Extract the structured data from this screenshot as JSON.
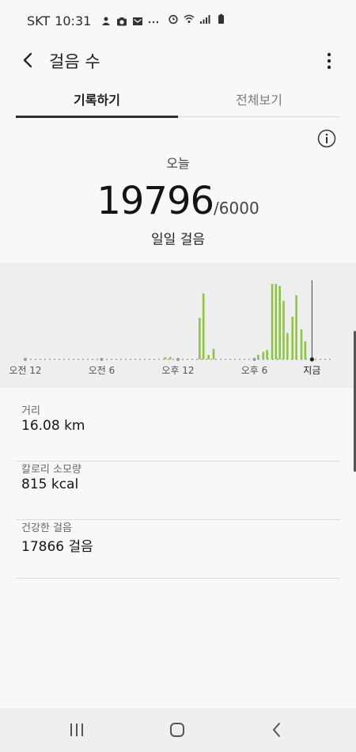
{
  "status": {
    "carrier": "SKT",
    "time": "10:31",
    "left_icons": [
      "notification-icon",
      "camera-icon",
      "mail-icon",
      "more-dots-icon"
    ],
    "right_icons": [
      "alarm-icon",
      "wifi-icon",
      "signal-icon",
      "battery-icon"
    ]
  },
  "appbar": {
    "title": "걸음 수"
  },
  "tabs": [
    {
      "label": "기록하기",
      "active": true
    },
    {
      "label": "전체보기",
      "active": false
    }
  ],
  "summary": {
    "period_label": "오늘",
    "steps": "19796",
    "goal": "/6000",
    "caption": "일일 걸음"
  },
  "chart_data": {
    "type": "bar",
    "x_tick_labels": [
      "오전 12",
      "오전 6",
      "오후 12",
      "오후 6",
      "지금"
    ],
    "x_range_hours": [
      0,
      24
    ],
    "now_hour": 22.53,
    "bar_hours": [
      11.0,
      11.4,
      13.7,
      14.0,
      14.4,
      14.8,
      18.3,
      18.7,
      19.0,
      19.4,
      19.7,
      20.0,
      20.3,
      20.6,
      21.0,
      21.3,
      21.7,
      22.0
    ],
    "bar_values": [
      60,
      60,
      1100,
      1750,
      120,
      280,
      120,
      200,
      250,
      2000,
      2000,
      1950,
      1550,
      700,
      1130,
      1700,
      800,
      480
    ],
    "ylim": [
      0,
      2100
    ],
    "color": "#8cc63f",
    "grid": false
  },
  "stats": [
    {
      "label": "거리",
      "value": "16.08 km"
    },
    {
      "label": "칼로리 소모량",
      "value": "815 kcal"
    },
    {
      "label": "건강한 걸음",
      "value": "17866 걸음"
    }
  ]
}
